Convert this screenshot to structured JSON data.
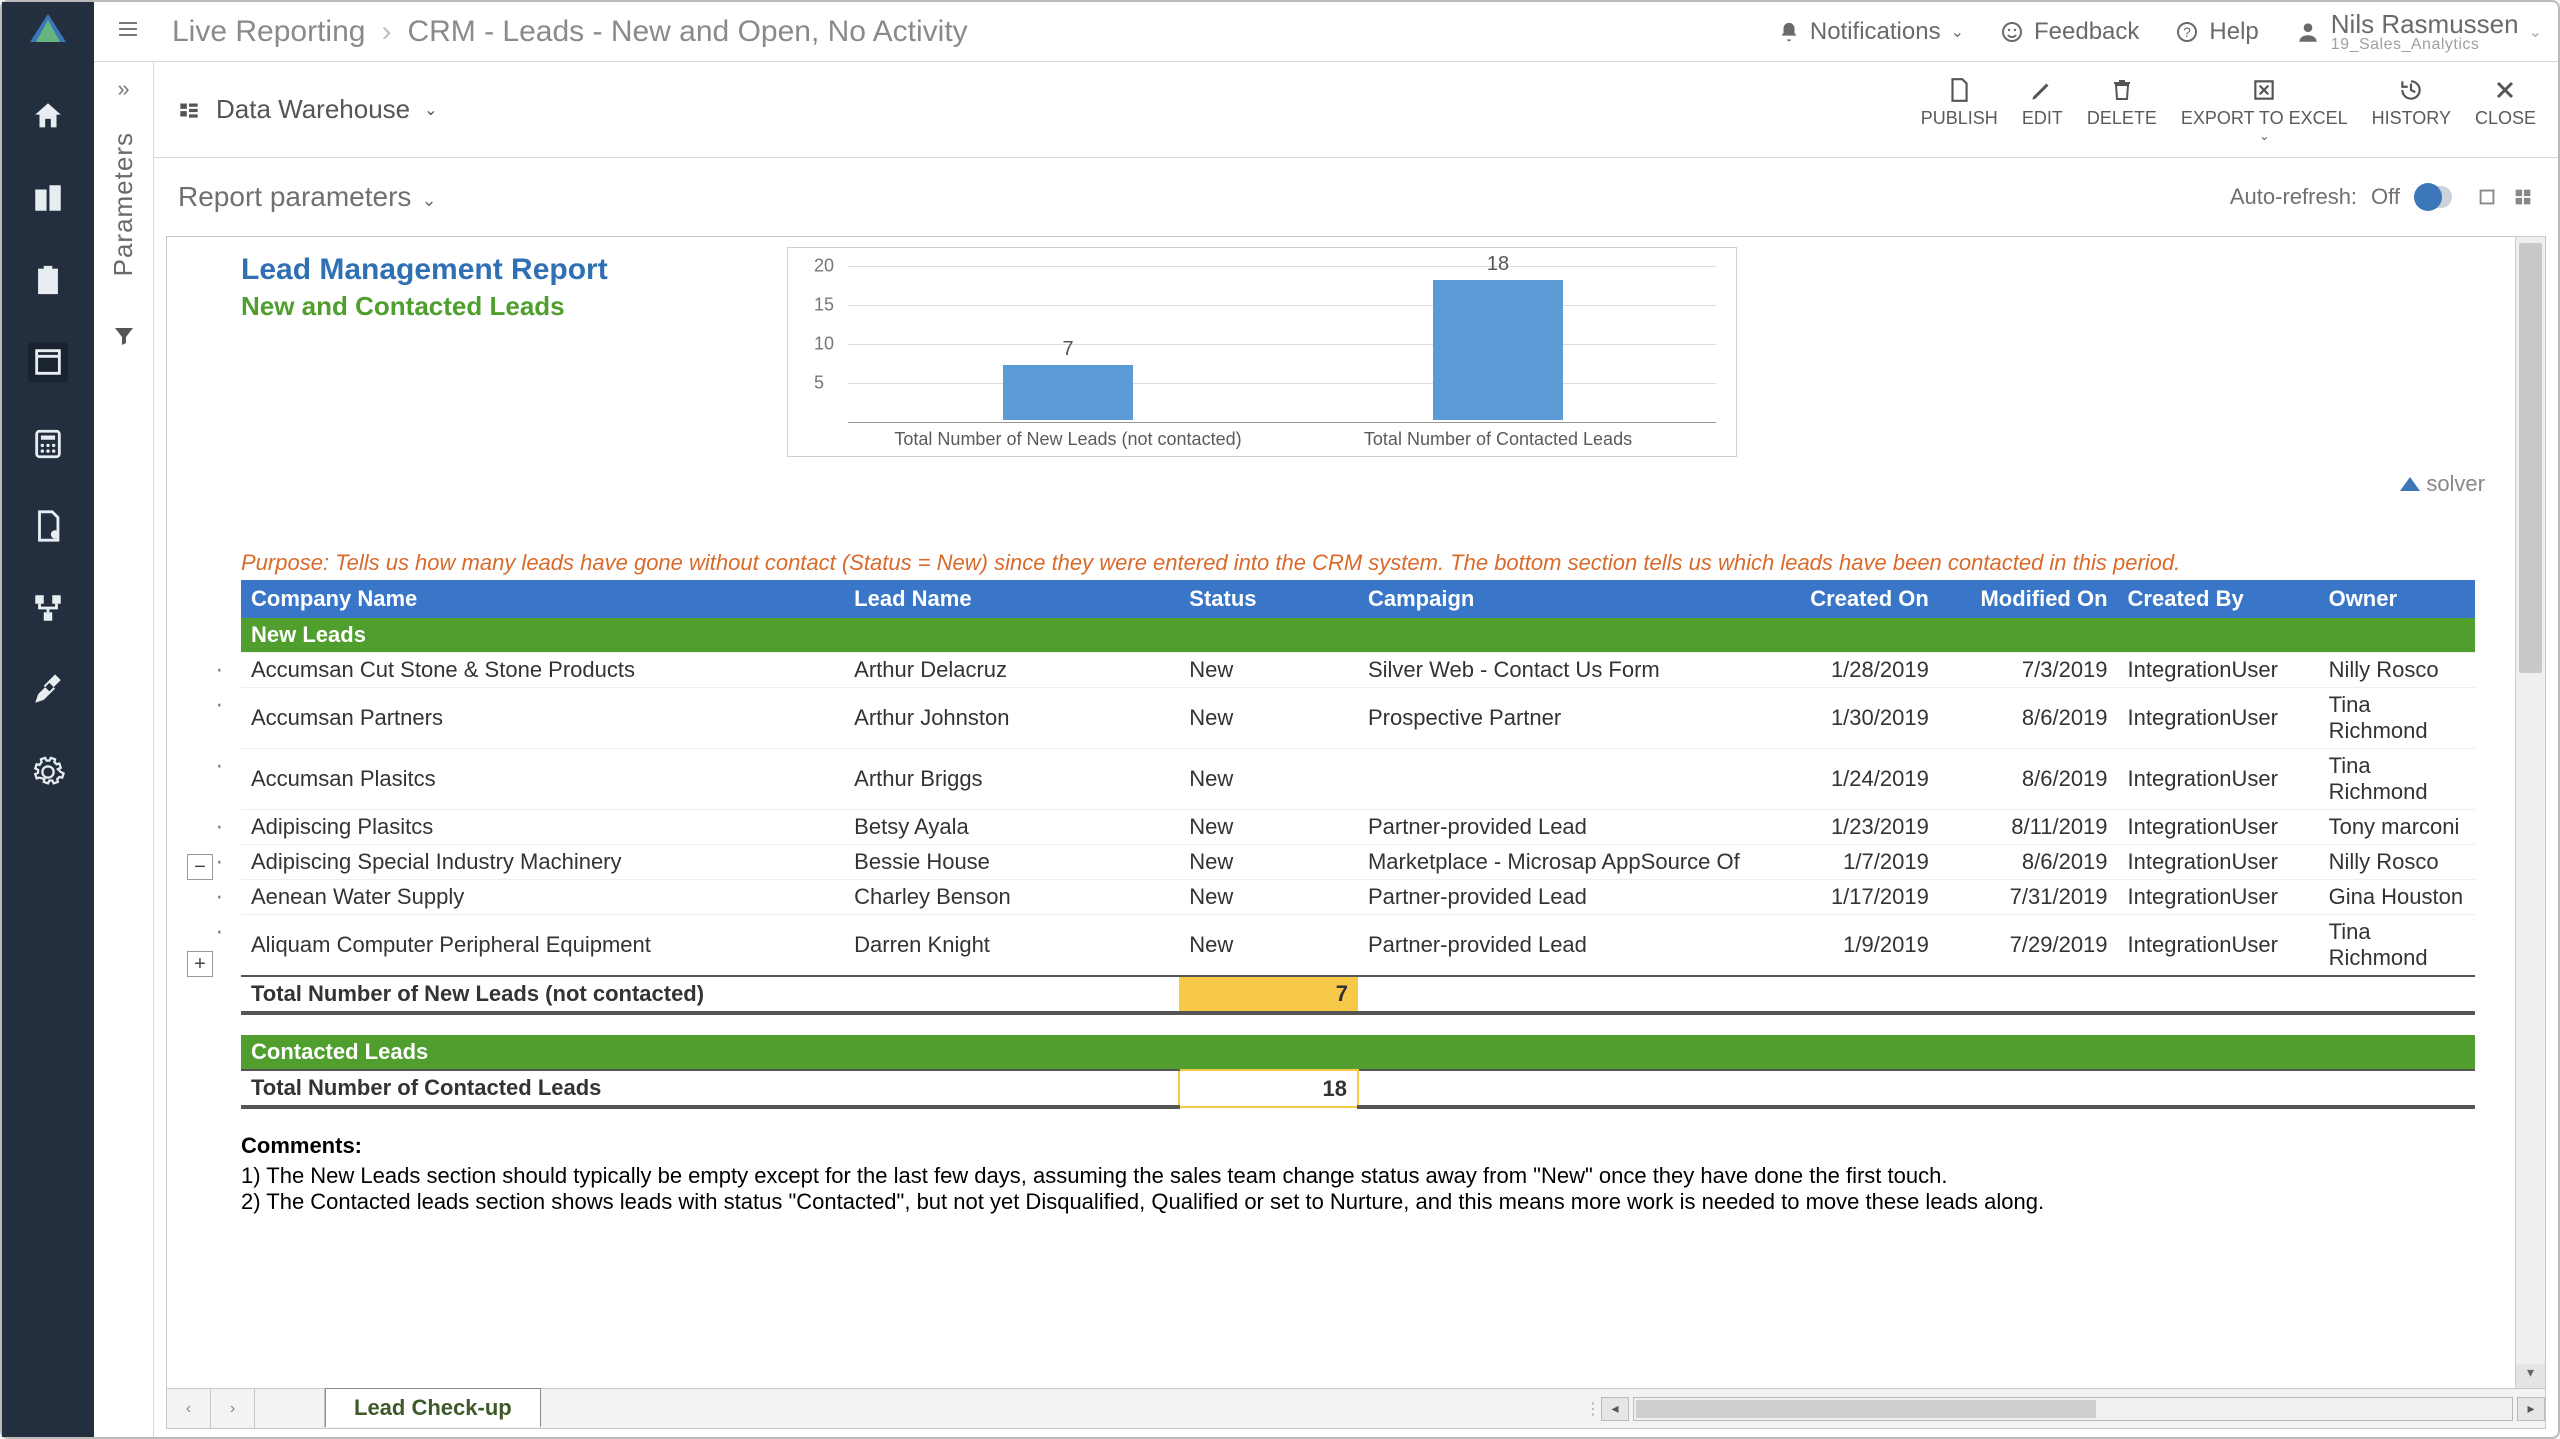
{
  "header": {
    "breadcrumb_root": "Live Reporting",
    "breadcrumb_page": "CRM - Leads - New and Open, No Activity",
    "notifications": "Notifications",
    "feedback": "Feedback",
    "help": "Help",
    "user_name": "Nils Rasmussen",
    "user_role": "19_Sales_Analytics"
  },
  "toolbar": {
    "data_source": "Data Warehouse",
    "actions": {
      "publish": "PUBLISH",
      "edit": "EDIT",
      "delete": "DELETE",
      "export_excel": "EXPORT TO EXCEL",
      "history": "HISTORY",
      "close": "CLOSE"
    }
  },
  "param_panel_label": "Parameters",
  "report_params_label": "Report parameters",
  "auto_refresh_label": "Auto-refresh:",
  "auto_refresh_state": "Off",
  "report": {
    "title": "Lead Management Report",
    "subtitle": "New and Contacted Leads",
    "purpose": "Purpose: Tells us how many leads have gone without contact (Status = New) since they were entered into the CRM system.  The bottom section tells us which leads have been contacted in this period.",
    "brand": "solver",
    "columns": {
      "company": "Company Name",
      "lead": "Lead Name",
      "status": "Status",
      "campaign": "Campaign",
      "created": "Created On",
      "modified": "Modified On",
      "createdby": "Created By",
      "owner": "Owner"
    },
    "section_new": "New Leads",
    "section_contacted": "Contacted Leads",
    "rows_new": [
      {
        "company": "Accumsan Cut Stone & Stone Products",
        "lead": "Arthur Delacruz",
        "status": "New",
        "campaign": "Silver Web - Contact Us Form",
        "created": "1/28/2019",
        "modified": "7/3/2019",
        "createdby": "IntegrationUser",
        "owner": "Nilly Rosco"
      },
      {
        "company": "Accumsan Partners",
        "lead": "Arthur Johnston",
        "status": "New",
        "campaign": "Prospective Partner",
        "created": "1/30/2019",
        "modified": "8/6/2019",
        "createdby": "IntegrationUser",
        "owner": "Tina Richmond"
      },
      {
        "company": "Accumsan Plasitcs",
        "lead": "Arthur Briggs",
        "status": "New",
        "campaign": "",
        "created": "1/24/2019",
        "modified": "8/6/2019",
        "createdby": "IntegrationUser",
        "owner": "Tina Richmond"
      },
      {
        "company": "Adipiscing Plasitcs",
        "lead": "Betsy Ayala",
        "status": "New",
        "campaign": "Partner-provided Lead",
        "created": "1/23/2019",
        "modified": "8/11/2019",
        "createdby": "IntegrationUser",
        "owner": "Tony marconi"
      },
      {
        "company": "Adipiscing Special Industry Machinery",
        "lead": "Bessie House",
        "status": "New",
        "campaign": "Marketplace - Microsap AppSource Of",
        "created": "1/7/2019",
        "modified": "8/6/2019",
        "createdby": "IntegrationUser",
        "owner": "Nilly Rosco"
      },
      {
        "company": "Aenean Water Supply",
        "lead": "Charley Benson",
        "status": "New",
        "campaign": "Partner-provided Lead",
        "created": "1/17/2019",
        "modified": "7/31/2019",
        "createdby": "IntegrationUser",
        "owner": "Gina Houston"
      },
      {
        "company": "Aliquam Computer Peripheral Equipment",
        "lead": "Darren Knight",
        "status": "New",
        "campaign": "Partner-provided Lead",
        "created": "1/9/2019",
        "modified": "7/29/2019",
        "createdby": "IntegrationUser",
        "owner": "Tina Richmond"
      }
    ],
    "total_new_label": "Total Number of New Leads (not contacted)",
    "total_new_value": "7",
    "total_contacted_label": "Total Number of Contacted Leads",
    "total_contacted_value": "18",
    "comments_header": "Comments:",
    "comment1": "1) The New Leads section should typically be empty except for the last few days, assuming the sales team change status away from \"New\" once they have done the first touch.",
    "comment2": "2) The Contacted leads section shows leads with status \"Contacted\", but not yet Disqualified, Qualified or set to Nurture, and this means more work is needed to move these leads along."
  },
  "chart_data": {
    "type": "bar",
    "categories": [
      "Total Number of New Leads (not contacted)",
      "Total Number of Contacted Leads"
    ],
    "values": [
      7,
      18
    ],
    "ylim": [
      0,
      20
    ],
    "yticks": [
      5,
      10,
      15,
      20
    ]
  },
  "sheet_tab": "Lead Check-up"
}
